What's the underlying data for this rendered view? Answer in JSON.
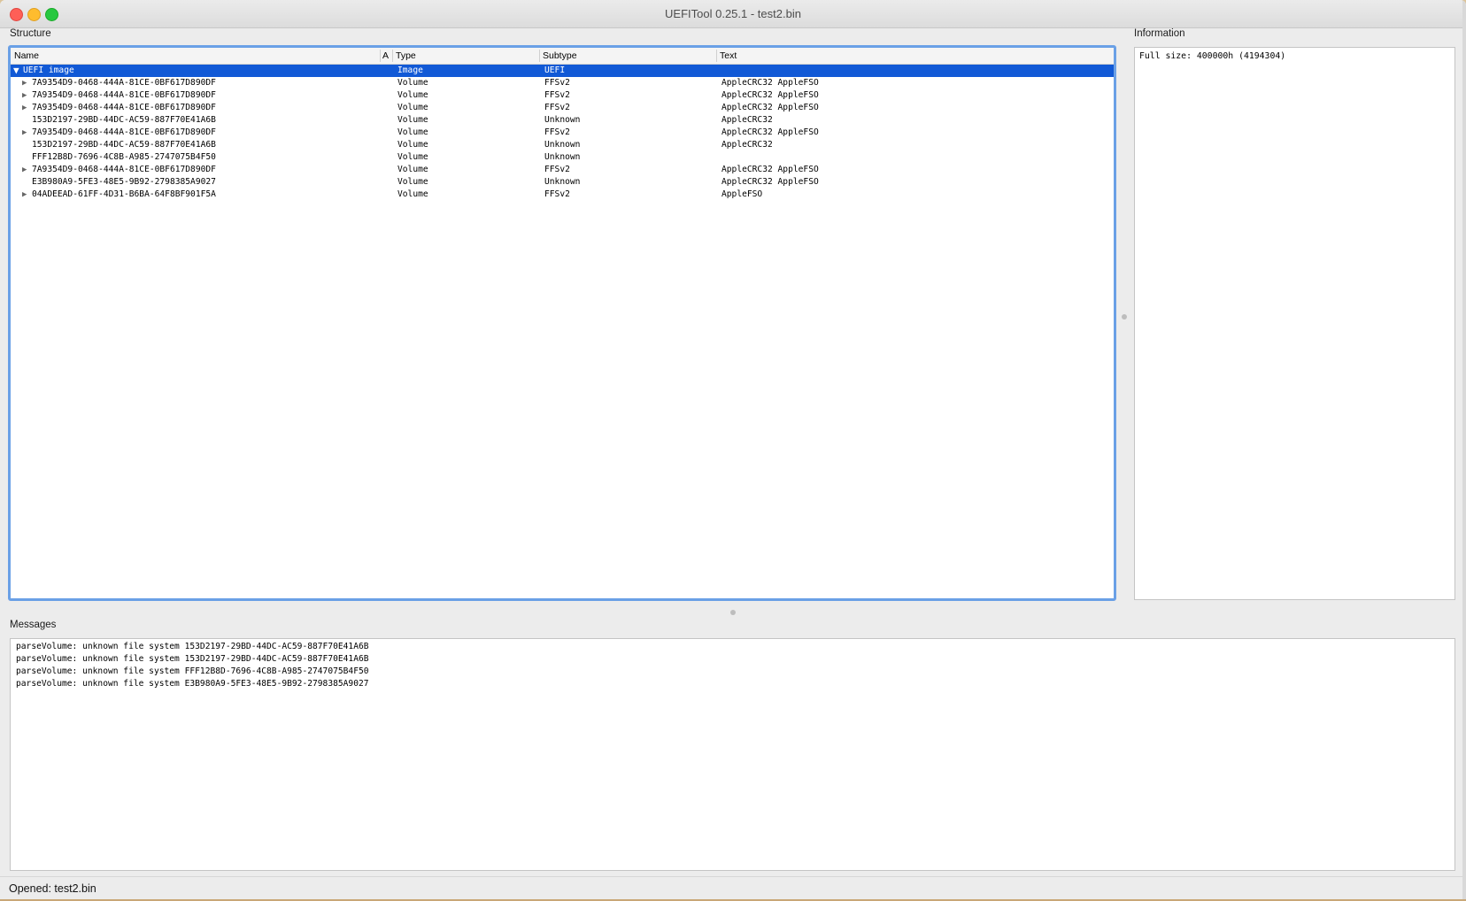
{
  "window": {
    "title": "UEFITool 0.25.1 - test2.bin"
  },
  "structure": {
    "label": "Structure",
    "columns": {
      "name": "Name",
      "action": "A",
      "type": "Type",
      "subtype": "Subtype",
      "text": "Text"
    },
    "rows": [
      {
        "name": "UEFI image",
        "type": "Image",
        "subtype": "UEFI",
        "text": "",
        "expander": "expanded",
        "selected": true
      },
      {
        "name": "7A9354D9-0468-444A-81CE-0BF617D890DF",
        "type": "Volume",
        "subtype": "FFSv2",
        "text": "AppleCRC32 AppleFSO",
        "expander": "collapsed"
      },
      {
        "name": "7A9354D9-0468-444A-81CE-0BF617D890DF",
        "type": "Volume",
        "subtype": "FFSv2",
        "text": "AppleCRC32 AppleFSO",
        "expander": "collapsed"
      },
      {
        "name": "7A9354D9-0468-444A-81CE-0BF617D890DF",
        "type": "Volume",
        "subtype": "FFSv2",
        "text": "AppleCRC32 AppleFSO",
        "expander": "collapsed"
      },
      {
        "name": "153D2197-29BD-44DC-AC59-887F70E41A6B",
        "type": "Volume",
        "subtype": "Unknown",
        "text": "AppleCRC32",
        "expander": "none"
      },
      {
        "name": "7A9354D9-0468-444A-81CE-0BF617D890DF",
        "type": "Volume",
        "subtype": "FFSv2",
        "text": "AppleCRC32 AppleFSO",
        "expander": "collapsed"
      },
      {
        "name": "153D2197-29BD-44DC-AC59-887F70E41A6B",
        "type": "Volume",
        "subtype": "Unknown",
        "text": "AppleCRC32",
        "expander": "none"
      },
      {
        "name": "FFF12B8D-7696-4C8B-A985-2747075B4F50",
        "type": "Volume",
        "subtype": "Unknown",
        "text": "",
        "expander": "none"
      },
      {
        "name": "7A9354D9-0468-444A-81CE-0BF617D890DF",
        "type": "Volume",
        "subtype": "FFSv2",
        "text": "AppleCRC32 AppleFSO",
        "expander": "collapsed"
      },
      {
        "name": "E3B980A9-5FE3-48E5-9B92-2798385A9027",
        "type": "Volume",
        "subtype": "Unknown",
        "text": "AppleCRC32 AppleFSO",
        "expander": "none"
      },
      {
        "name": "04ADEEAD-61FF-4D31-B6BA-64F8BF901F5A",
        "type": "Volume",
        "subtype": "FFSv2",
        "text": "AppleFSO",
        "expander": "collapsed"
      }
    ],
    "selection_color": "#1159d6"
  },
  "information": {
    "label": "Information",
    "text": "Full size: 400000h (4194304)"
  },
  "messages": {
    "label": "Messages",
    "lines": [
      "parseVolume: unknown file system 153D2197-29BD-44DC-AC59-887F70E41A6B",
      "parseVolume: unknown file system 153D2197-29BD-44DC-AC59-887F70E41A6B",
      "parseVolume: unknown file system FFF12B8D-7696-4C8B-A985-2747075B4F50",
      "parseVolume: unknown file system E3B980A9-5FE3-48E5-9B92-2798385A9027"
    ]
  },
  "status": {
    "text": "Opened: test2.bin"
  }
}
